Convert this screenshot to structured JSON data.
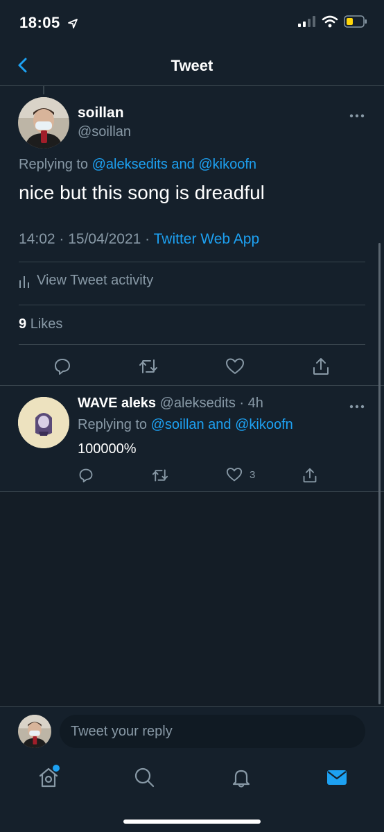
{
  "status_bar": {
    "time": "18:05"
  },
  "header": {
    "title": "Tweet"
  },
  "tweet": {
    "name": "soillan",
    "handle": "@soillan",
    "replying_prefix": "Replying to",
    "replying_to": "@aleksedits and @kikoofn",
    "text": "nice but this song is dreadful",
    "timestamp": "14:02 · 15/04/2021 · ",
    "source": "Twitter Web App",
    "activity_label": "View Tweet activity",
    "likes_count": "9",
    "likes_label": "Likes"
  },
  "reply": {
    "name": "WAVE aleks",
    "handle": "@aleksedits",
    "time": "· 4h",
    "replying_prefix": "Replying to",
    "replying_to": "@soillan and @kikoofn",
    "text": "100000%",
    "like_count": "3"
  },
  "composer": {
    "placeholder": "Tweet your reply"
  },
  "colors": {
    "background": "#15202b",
    "accent": "#1da1f2",
    "muted": "#8899a6",
    "divider": "#38444d"
  }
}
